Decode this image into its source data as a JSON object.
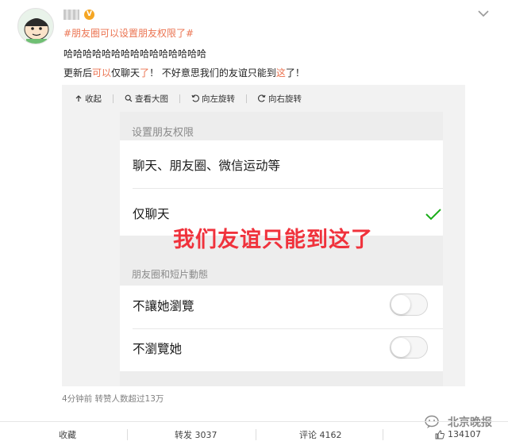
{
  "post": {
    "hashtag": "#朋友圈可以设置朋友权限了#",
    "line1": "哈哈哈哈哈哈哈哈哈哈哈哈哈哈哈",
    "line2_a": "更新后",
    "line2_hl": "可以",
    "line2_b": "仅聊天",
    "line2_hl2": "了",
    "line2_c": "！ 不好意思我们的友谊只能到",
    "line2_hl3": "这",
    "line2_d": "了！"
  },
  "toolbar": {
    "collapse": "收起",
    "view_large": "查看大图",
    "rotate_left": "向左旋转",
    "rotate_right": "向右旋转"
  },
  "settings": {
    "section1_title": "设置朋友权限",
    "option_all": "聊天、朋友圈、微信运动等",
    "option_chat_only": "仅聊天",
    "overlay_text": "我们友谊只能到这了",
    "section2_title": "朋友圈和短片動態",
    "toggle1_label": "不讓她瀏覽",
    "toggle2_label": "不瀏覽她"
  },
  "meta": {
    "time_info": "4分钟前 转赞人数超过13万"
  },
  "watermark": {
    "text": "北京晚报"
  },
  "actions": {
    "favorite": "收藏",
    "repost": "转发 3037",
    "comment": "评论 4162",
    "like": "134107"
  },
  "colors": {
    "accent": "#eb7350",
    "check": "#1aad19",
    "overlay": "#f0323c",
    "badge": "#f5a623"
  },
  "icons": {
    "collapse": "arrow-up-icon",
    "view_large": "magnifier-icon",
    "rotate_left": "rotate-left-icon",
    "rotate_right": "rotate-right-icon",
    "check": "checkmark-icon",
    "chevron": "chevron-down-icon",
    "like": "thumbs-up-icon",
    "verified": "verified-badge-icon"
  }
}
